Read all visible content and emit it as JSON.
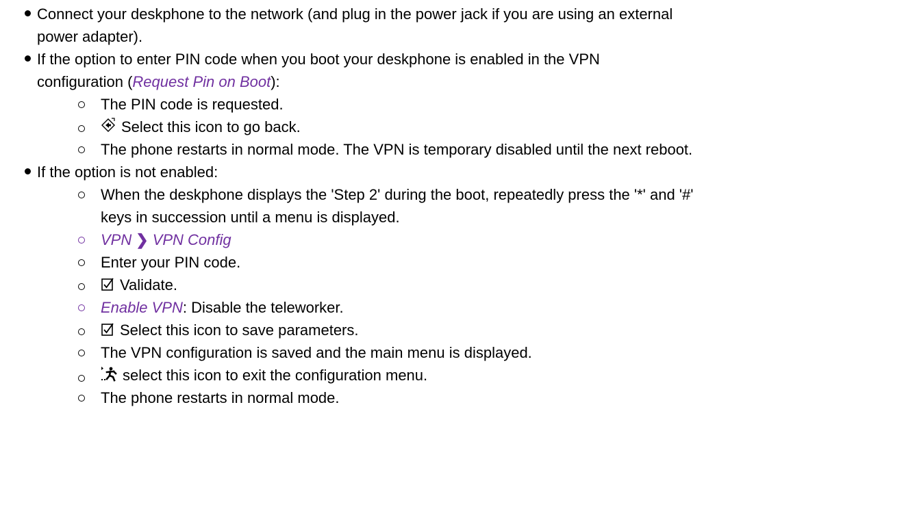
{
  "items": [
    {
      "text": "Connect your deskphone to the network (and plug in the power jack if you are using an external power adapter).",
      "line2": "power adapter)."
    },
    {
      "pre": "If the option to enter PIN code when you boot your deskphone is enabled in the VPN",
      "pre2": "configuration (",
      "em": "Request Pin on Boot",
      "post": "):",
      "sub": [
        {
          "text": "The PIN code is requested."
        },
        {
          "icon": "back-arrow-icon",
          "text": "Select this icon to go back."
        },
        {
          "text": "The phone restarts in normal mode. The VPN is temporary disabled until the next reboot."
        }
      ]
    },
    {
      "text": "If the option is not enabled:",
      "sub": [
        {
          "text": "When the deskphone displays the 'Step 2' during the boot, repeatedly press the '*' and '#'",
          "text2": "keys in succession until a menu is displayed."
        },
        {
          "path": [
            "VPN",
            "VPN Config"
          ],
          "sep": "❯"
        },
        {
          "text": "Enter your PIN code."
        },
        {
          "icon": "checkbox-validate-icon",
          "text": "Validate."
        },
        {
          "em": "Enable VPN",
          "text": ": Disable the teleworker."
        },
        {
          "icon": "checkbox-validate-icon",
          "text": "Select this icon to save parameters."
        },
        {
          "text": "The VPN configuration is saved and the main menu is displayed."
        },
        {
          "icon": "exit-running-man-icon",
          "text": "select this icon to exit the configuration menu."
        },
        {
          "text": "The phone restarts in normal mode."
        }
      ]
    }
  ]
}
